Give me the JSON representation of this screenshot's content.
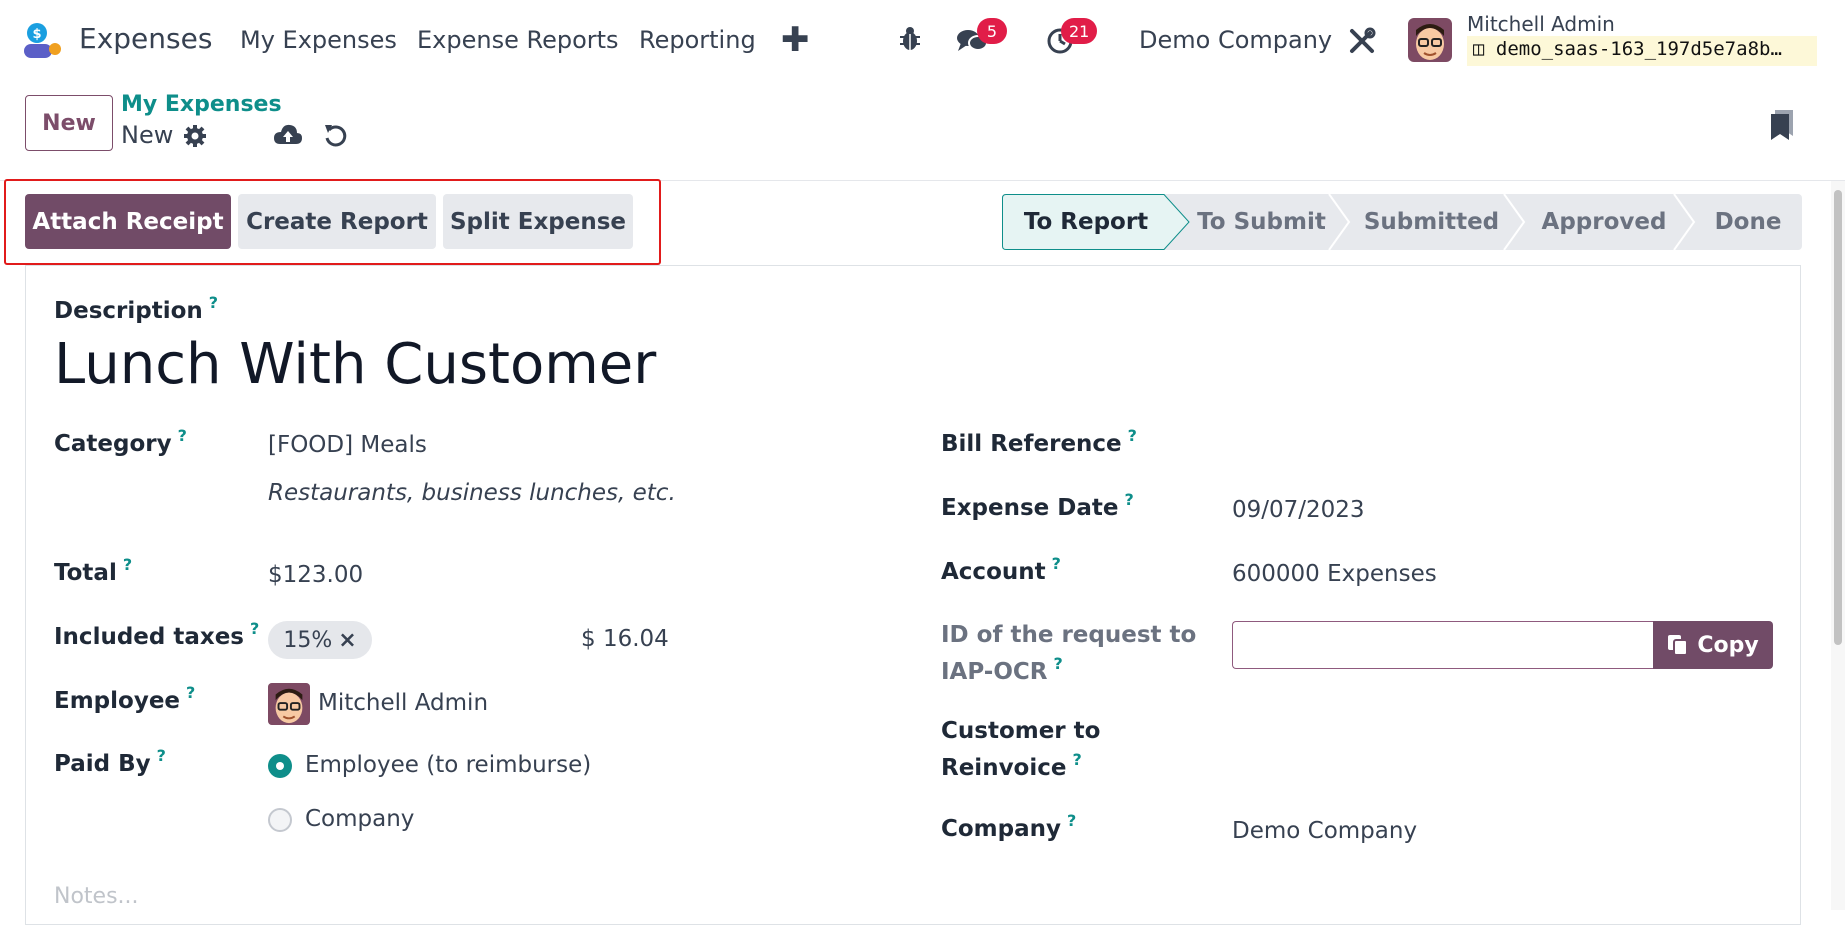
{
  "navbar": {
    "app_name": "Expenses",
    "menus": [
      "My Expenses",
      "Expense Reports",
      "Reporting"
    ],
    "plus": "✚",
    "messages_count": "5",
    "activities_count": "21",
    "company": "Demo Company",
    "user_name": "Mitchell Admin",
    "db_name": "demo_saas-163_197d5e7a8b…"
  },
  "control_panel": {
    "new_label": "New",
    "breadcrumb_parent": "My Expenses",
    "breadcrumb_current": "New"
  },
  "header_buttons": {
    "attach_receipt": "Attach Receipt",
    "create_report": "Create Report",
    "split_expense": "Split Expense"
  },
  "statusbar": {
    "stages": [
      "To Report",
      "To Submit",
      "Submitted",
      "Approved",
      "Done"
    ],
    "active": "To Report"
  },
  "form": {
    "description_label": "Description",
    "description_value": "Lunch With Customer",
    "category_label": "Category",
    "category_value": "[FOOD] Meals",
    "category_hint": "Restaurants, business lunches, etc.",
    "total_label": "Total",
    "total_value": "$123.00",
    "taxes_label": "Included taxes",
    "tax_tag": "15%",
    "tax_amount": "$ 16.04",
    "employee_label": "Employee",
    "employee_value": "Mitchell Admin",
    "paid_by_label": "Paid By",
    "paid_by_options": [
      "Employee (to reimburse)",
      "Company"
    ],
    "paid_by_selected": "Employee (to reimburse)",
    "bill_reference_label": "Bill Reference",
    "expense_date_label": "Expense Date",
    "expense_date_value": "09/07/2023",
    "account_label": "Account",
    "account_value": "600000 Expenses",
    "ocr_label_line1": "ID of the request to",
    "ocr_label_line2": "IAP-OCR",
    "ocr_value": "",
    "copy_label": "Copy",
    "reinvoice_label_line1": "Customer to",
    "reinvoice_label_line2": "Reinvoice",
    "company_label": "Company",
    "company_value": "Demo Company",
    "notes_placeholder": "Notes...",
    "help_mark": "?"
  },
  "colors": {
    "primary": "#714b67",
    "teal": "#0e8e8a",
    "badge": "#e11d48",
    "highlight": "#e11b1b"
  },
  "icons": [
    "bug-icon",
    "chat-icon",
    "clock-icon",
    "tools-icon",
    "gear-icon",
    "cloud-upload-icon",
    "undo-icon",
    "bookmark-icon",
    "copy-icon",
    "close-icon",
    "database-icon"
  ]
}
